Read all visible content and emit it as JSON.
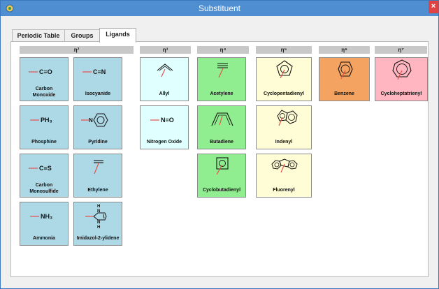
{
  "window": {
    "title": "Substituent",
    "close_glyph": "×"
  },
  "tabs": [
    {
      "label": "Periodic Table",
      "active": false
    },
    {
      "label": "Groups",
      "active": false
    },
    {
      "label": "Ligands",
      "active": true
    }
  ],
  "groups": [
    {
      "label": "η²"
    },
    {
      "label": "η³"
    },
    {
      "label": "η⁴"
    },
    {
      "label": "η⁵"
    },
    {
      "label": "η⁶"
    },
    {
      "label": "η⁷"
    }
  ],
  "colors": {
    "eta2": "#add8e6",
    "eta3": "#e0ffff",
    "eta4": "#90ee90",
    "eta5": "#fffdd5",
    "eta6": "#f4a460",
    "eta7": "#ffb6c1",
    "bond_red": "#e8504a"
  },
  "ligands": {
    "carbon_monoxide": {
      "label": "Carbon Monoxide",
      "formula": "C≡O",
      "icon": "carbon-monoxide-icon"
    },
    "isocyanide": {
      "label": "Isocyanide",
      "formula": "C≡N",
      "icon": "isocyanide-icon"
    },
    "phosphine": {
      "label": "Phosphine",
      "formula": "PH₃",
      "icon": "phosphine-icon"
    },
    "pyridine": {
      "label": "Pyridine",
      "formula": "N",
      "icon": "pyridine-icon"
    },
    "carbon_monosulfide": {
      "label": "Carbon Monosulfide",
      "formula": "C≡S",
      "icon": "carbon-monosulfide-icon"
    },
    "ethylene": {
      "label": "Ethylene",
      "icon": "ethylene-icon"
    },
    "ammonia": {
      "label": "Ammonia",
      "formula": "NH₃",
      "icon": "ammonia-icon"
    },
    "imidazol_2_ylidene": {
      "label": "Imidazol-2-ylidene",
      "atom_top": "H",
      "atom_n_top": "N",
      "atom_n_bottom": "N",
      "atom_bottom": "H",
      "icon": "imidazol-2-ylidene-icon"
    },
    "allyl": {
      "label": "Allyl",
      "icon": "allyl-icon"
    },
    "nitrogen_oxide": {
      "label": "Nitrogen Oxide",
      "formula": "N=O",
      "icon": "nitrogen-oxide-icon"
    },
    "acetylene": {
      "label": "Acetylene",
      "icon": "acetylene-icon"
    },
    "butadiene": {
      "label": "Butadiene",
      "icon": "butadiene-icon"
    },
    "cyclobutadienyl": {
      "label": "Cyclobutadienyl",
      "icon": "cyclobutadienyl-icon"
    },
    "cyclopentadienyl": {
      "label": "Cyclopentadienyl",
      "icon": "cyclopentadienyl-icon"
    },
    "indenyl": {
      "label": "Indenyl",
      "icon": "indenyl-icon"
    },
    "fluorenyl": {
      "label": "Fluorenyl",
      "icon": "fluorenyl-icon"
    },
    "benzene": {
      "label": "Benzene",
      "icon": "benzene-icon"
    },
    "cycloheptatrienyl": {
      "label": "Cycloheptatrienyl",
      "icon": "cycloheptatrienyl-icon"
    }
  }
}
